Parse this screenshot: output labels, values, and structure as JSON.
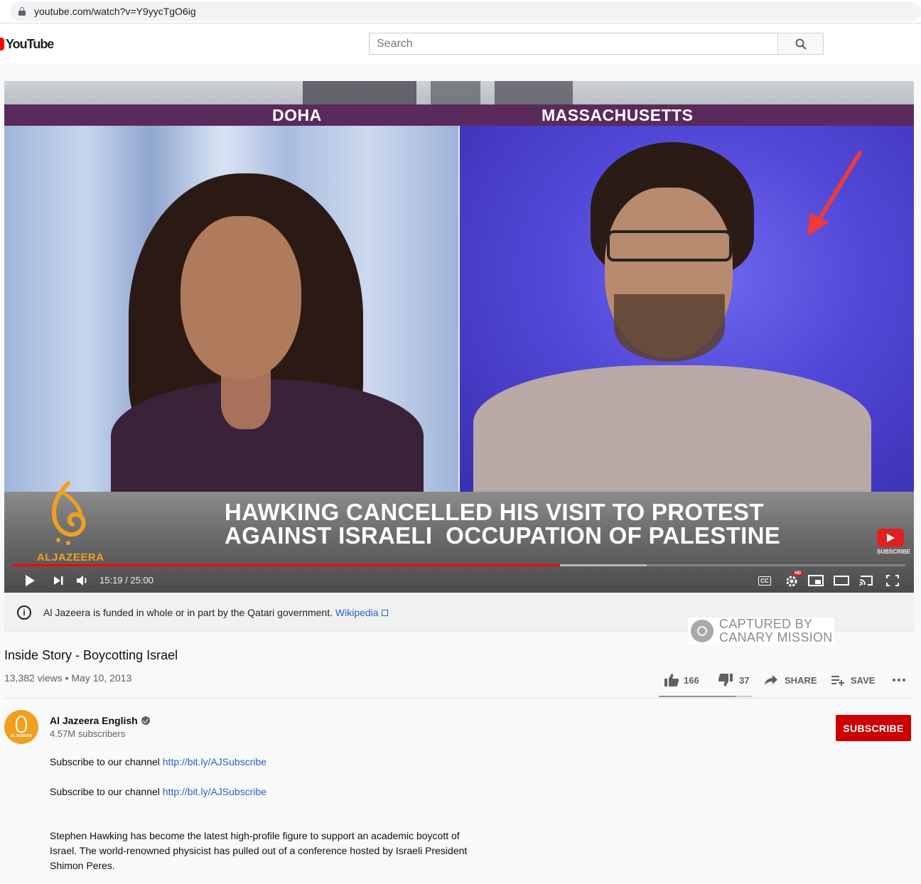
{
  "browser": {
    "url": "youtube.com/watch?v=Y9yycTgO6ig"
  },
  "header": {
    "logo_text": "YouTube",
    "search_placeholder": "Search"
  },
  "player": {
    "location_left": "DOHA",
    "location_right": "MASSACHUSETTS",
    "lower_third_line1": "HAWKING CANCELLED HIS VISIT TO PROTEST",
    "lower_third_line2": "AGAINST ISRAELI  OCCUPATION OF PALESTINE",
    "broadcaster_logo": "ALJAZEERA",
    "subscribe_badge": "SUBSCRIBE",
    "time_display": "15:19 / 25:00",
    "progress_fraction": 0.6127,
    "buffer_fraction": 0.71,
    "controls": [
      "play-icon",
      "next-icon",
      "volume-icon",
      "captions-icon",
      "settings-icon",
      "miniplayer-icon",
      "theater-icon",
      "cast-icon",
      "fullscreen-icon"
    ],
    "cc_label": "CC",
    "hd_badge": "HD"
  },
  "disclaimer": {
    "text": "Al Jazeera is funded in whole or in part by the Qatari government.",
    "link": "Wikipedia"
  },
  "watermark": {
    "line1": "CAPTURED BY",
    "line2": "CANARY MISSION"
  },
  "video": {
    "title": "Inside Story - Boycotting Israel",
    "stats": "13,382 views • May 10, 2013",
    "likes": "166",
    "dislikes": "37",
    "share_label": "SHARE",
    "save_label": "SAVE",
    "like_fraction": 0.818
  },
  "channel": {
    "name": "Al Jazeera English",
    "subscribers": "4.57M subscribers",
    "subscribe_label": "SUBSCRIBE",
    "avatar_text": "ALJAZEERA"
  },
  "description": {
    "line1_text": "Subscribe to our channel ",
    "line1_link": "http://bit.ly/AJSubscribe",
    "line2_text": "Subscribe to our channel ",
    "line2_link": "http://bit.ly/AJSubscribe",
    "paragraph": "Stephen Hawking has become the latest high-profile figure to support an academic boycott of Israel. The world-renowned physicist has pulled out of a conference hosted by Israeli President Shimon Peres."
  },
  "colors": {
    "accent_red": "#ff0000",
    "subscribe_red": "#cc0000",
    "link_blue": "#2a62c5",
    "location_bar": "#5a2a5c",
    "aj_gold": "#f0a020"
  }
}
